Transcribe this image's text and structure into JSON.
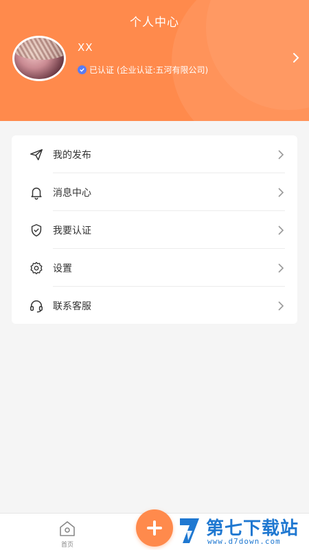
{
  "header": {
    "title": "个人中心",
    "user_name": "XX",
    "verify_text": "已认证 (企业认证:五河有限公司)",
    "accent": "#ff8a4c"
  },
  "menu": {
    "items": [
      {
        "label": "我的发布",
        "icon": "paper-plane-icon"
      },
      {
        "label": "消息中心",
        "icon": "bell-icon"
      },
      {
        "label": "我要认证",
        "icon": "shield-check-icon"
      },
      {
        "label": "设置",
        "icon": "gear-icon"
      },
      {
        "label": "联系客服",
        "icon": "headset-icon"
      }
    ]
  },
  "tabbar": {
    "home_label": "首页",
    "fab_icon": "plus-icon"
  },
  "watermark": {
    "title": "第七下载站",
    "url": "www.d7down.com"
  }
}
